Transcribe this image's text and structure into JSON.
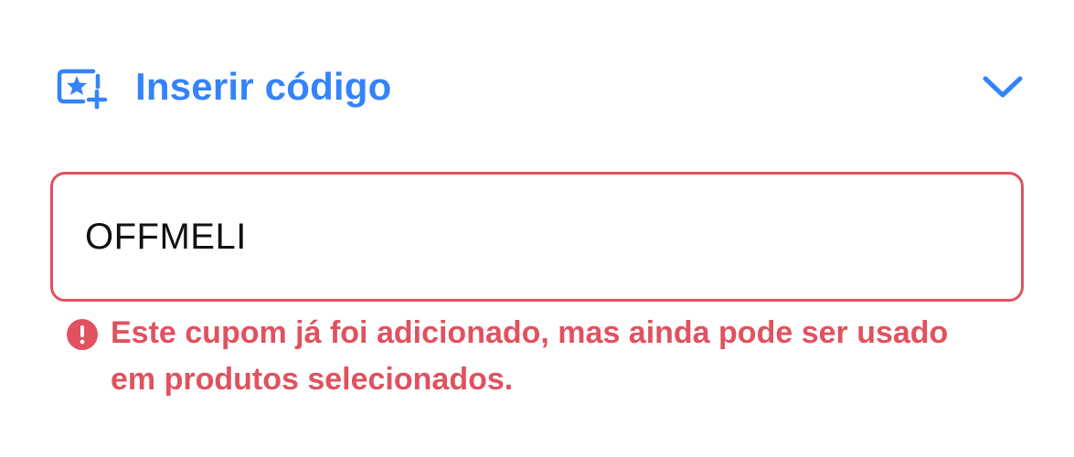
{
  "coupon": {
    "header": {
      "title": "Inserir código",
      "icon": "coupon-star-plus-icon",
      "toggle_icon": "chevron-down-icon"
    },
    "input": {
      "value": "OFFMELI",
      "placeholder": ""
    },
    "error": {
      "icon": "exclamation-circle-icon",
      "message": "Este cupom já foi adicionado, mas ainda pode ser usado em produtos selecionados."
    }
  },
  "colors": {
    "accent": "#3483fa",
    "error": "#e0525f",
    "text": "#111111",
    "background": "#ffffff"
  }
}
